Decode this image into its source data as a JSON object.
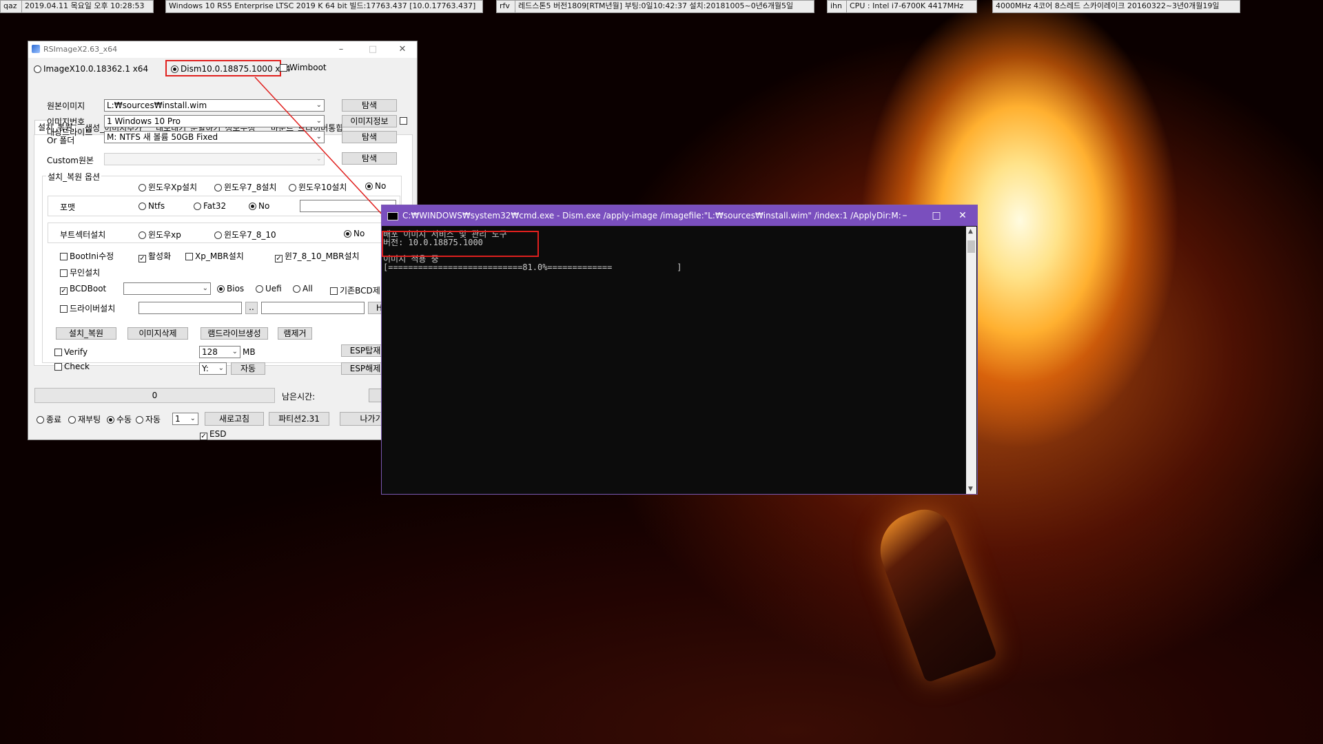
{
  "topbar": [
    {
      "id": "user",
      "text": "qaz"
    },
    {
      "id": "datetime",
      "text": "2019.04.11 목요일 오후 10:28:53"
    },
    {
      "id": "os",
      "text": "Windows 10 RS5 Enterprise LTSC 2019 K 64 bit 빌드:17763.437 [10.0.17763.437]"
    },
    {
      "id": "boot",
      "text": "rfv"
    },
    {
      "id": "build",
      "text": "레드스톤5 버전1809[RTM년월] 부팅:0일10:42:37 설치:20181005~0년6개월5일"
    },
    {
      "id": "host",
      "text": "ihn"
    },
    {
      "id": "cpu",
      "text": "CPU : Intel i7-6700K 4417MHz"
    },
    {
      "id": "cpu2",
      "text": "4000MHz 4코어 8스레드 스카이레이크 20160322~3년0개월19일"
    }
  ],
  "rsimage": {
    "title": "RSImageX2.63_x64",
    "engine_imagex": "ImageX10.0.18362.1 x64",
    "engine_dism": "Dism10.0.18875.1000 x64",
    "wimboot": "Wimboot",
    "tabs": [
      "설치_복원",
      "생성_이미지추가",
      "내보내기_분할하기_정보수정",
      "마운트_드라이버통합"
    ],
    "source_label": "원본이미지",
    "source_value": "L:₩sources₩install.wim",
    "index_label": "이미지번호",
    "index_value": "1  Windows 10 Pro",
    "target_label_1": "대상드라이브",
    "target_label_2": "Or 폴더",
    "target_value": "M:  NTFS  새 볼륨          50GB  Fixed",
    "custom_label": "Custom원본",
    "browse": "탐색",
    "image_info": "이미지정보",
    "options_title": "설치_복원 옵션",
    "opt_xp": "윈도우Xp설치",
    "opt_78": "윈도우7_8설치",
    "opt_10": "윈도우10설치",
    "opt_no": "No",
    "format_label": "포맷",
    "fmt_ntfs": "Ntfs",
    "fmt_fat32": "Fat32",
    "fmt_no": "No",
    "bootsector_label": "부트섹터설치",
    "bs_xp": "윈도우xp",
    "bs_78": "윈도우7_8_10",
    "bs_no": "No",
    "bootini": "BootIni수정",
    "activate": "활성화",
    "xp_mbr": "Xp_MBR설치",
    "w7_mbr": "윈7_8_10_MBR설치",
    "unattended": "무인설치",
    "bcdboot": "BCDBoot",
    "bios": "Bios",
    "uefi": "Uefi",
    "all": "All",
    "existing_bcd": "기존BCD제",
    "driver_install": "드라이버설치",
    "dots": "..",
    "ho": "Ho",
    "btn_install": "설치_복원",
    "btn_delete": "이미지삭제",
    "btn_ramdrive": "램드라이브생성",
    "btn_ramremove": "램제거",
    "verify": "Verify",
    "check": "Check",
    "ram_size": "128",
    "mb": "MB",
    "ram_letter": "Y:",
    "auto": "자동",
    "esp_mount": "ESP탑재",
    "esp_unmount": "ESP해제",
    "progress_value": "0",
    "remaining_label": "남은시간:",
    "cancel_partial": "취",
    "end_exit": "종료",
    "end_reboot": "재부팅",
    "end_manual": "수동",
    "end_auto": "자동",
    "count": "1",
    "refresh": "새로고침",
    "partition": "파티션2.31",
    "exit": "나가기",
    "esd": "ESD"
  },
  "cmd": {
    "title": "C:₩WINDOWS₩system32₩cmd.exe - Dism.exe  /apply-image /imagefile:\"L:₩sources₩install.wim\" /index:1 /ApplyDir:M:",
    "line1": "배포 이미지 서비스 및 관리 도구",
    "line2": "버전: 10.0.18875.1000",
    "line3": "이미지 적용 중",
    "line4": "[===========================81.0%=============             ]",
    "progress": 0.81
  },
  "colors": {
    "cmd_title_bg": "#7a4fbe",
    "highlight": "#e0201e"
  }
}
